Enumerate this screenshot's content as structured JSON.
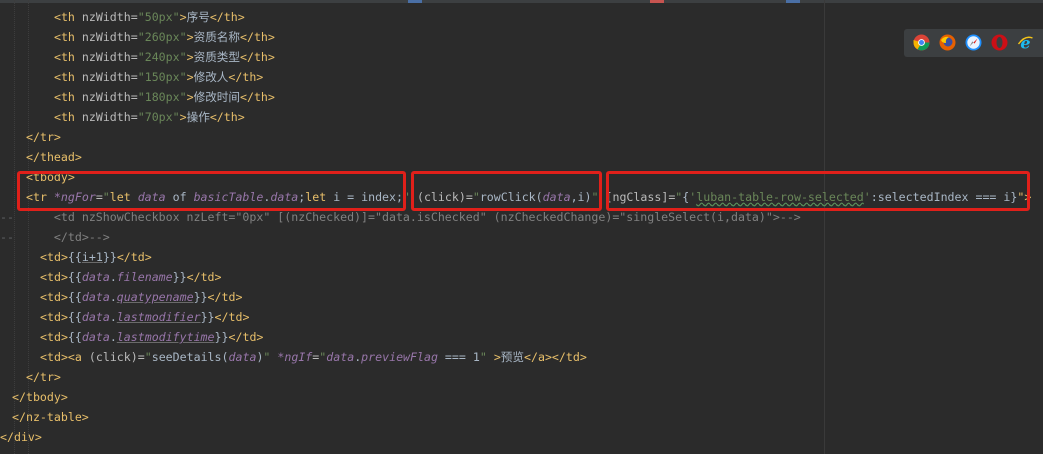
{
  "code_lines": [
    [
      {
        "t": "  <th ",
        "c": "tag"
      },
      {
        "t": "nzWidth=",
        "c": "attr"
      },
      {
        "t": "\"50px\"",
        "c": "str"
      },
      {
        "t": ">",
        "c": "tag"
      },
      {
        "t": "序号",
        "c": "txt"
      },
      {
        "t": "</th>",
        "c": "tag"
      }
    ],
    [
      {
        "t": "  <th ",
        "c": "tag"
      },
      {
        "t": "nzWidth=",
        "c": "attr"
      },
      {
        "t": "\"260px\"",
        "c": "str"
      },
      {
        "t": ">",
        "c": "tag"
      },
      {
        "t": "资质名称",
        "c": "txt"
      },
      {
        "t": "</th>",
        "c": "tag"
      }
    ],
    [
      {
        "t": "  <th ",
        "c": "tag"
      },
      {
        "t": "nzWidth=",
        "c": "attr"
      },
      {
        "t": "\"240px\"",
        "c": "str"
      },
      {
        "t": ">",
        "c": "tag"
      },
      {
        "t": "资质类型",
        "c": "txt"
      },
      {
        "t": "</th>",
        "c": "tag"
      }
    ],
    [
      {
        "t": "  <th ",
        "c": "tag"
      },
      {
        "t": "nzWidth=",
        "c": "attr"
      },
      {
        "t": "\"150px\"",
        "c": "str"
      },
      {
        "t": ">",
        "c": "tag"
      },
      {
        "t": "修改人",
        "c": "txt"
      },
      {
        "t": "</th>",
        "c": "tag"
      }
    ],
    [
      {
        "t": "  <th ",
        "c": "tag"
      },
      {
        "t": "nzWidth=",
        "c": "attr"
      },
      {
        "t": "\"180px\"",
        "c": "str"
      },
      {
        "t": ">",
        "c": "tag"
      },
      {
        "t": "修改时间",
        "c": "txt"
      },
      {
        "t": "</th>",
        "c": "tag"
      }
    ],
    [
      {
        "t": "  <th ",
        "c": "tag"
      },
      {
        "t": "nzWidth=",
        "c": "attr"
      },
      {
        "t": "\"70px\"",
        "c": "str"
      },
      {
        "t": ">",
        "c": "tag"
      },
      {
        "t": "操作",
        "c": "txt"
      },
      {
        "t": "</th>",
        "c": "tag"
      }
    ],
    [
      {
        "t": "</tr>",
        "c": "tag"
      }
    ],
    [
      {
        "t": "</thead>",
        "c": "tag"
      }
    ],
    [
      {
        "t": "<tbody>",
        "c": "tag"
      }
    ],
    [
      {
        "t": "<tr ",
        "c": "tag"
      },
      {
        "t": "*ngFor",
        "c": "purple"
      },
      {
        "t": "=",
        "c": "attr"
      },
      {
        "t": "\"",
        "c": "str"
      },
      {
        "t": "let ",
        "c": "tag"
      },
      {
        "t": "data ",
        "c": "purple"
      },
      {
        "t": "of ",
        "c": "txt"
      },
      {
        "t": "basicTable",
        "c": "purple"
      },
      {
        "t": ".",
        "c": "txt"
      },
      {
        "t": "data",
        "c": "purple"
      },
      {
        "t": ";",
        "c": "txt"
      },
      {
        "t": "let ",
        "c": "tag"
      },
      {
        "t": "i = index",
        "c": "txt"
      },
      {
        "t": ";",
        "c": "txt"
      },
      {
        "t": "\" ",
        "c": "str"
      },
      {
        "t": "(click)",
        "c": "attr"
      },
      {
        "t": "=",
        "c": "attr"
      },
      {
        "t": "\"",
        "c": "str"
      },
      {
        "t": "rowClick",
        "c": "txt"
      },
      {
        "t": "(",
        "c": "txt"
      },
      {
        "t": "data",
        "c": "purple"
      },
      {
        "t": ",i)",
        "c": "txt"
      },
      {
        "t": "\" ",
        "c": "str"
      },
      {
        "t": "[ngClass]",
        "c": "attr"
      },
      {
        "t": "=",
        "c": "attr"
      },
      {
        "t": "\"",
        "c": "str"
      },
      {
        "t": "{",
        "c": "txt"
      },
      {
        "t": "'",
        "c": "str"
      },
      {
        "t": "luban-table-row-selected",
        "c": "str squig"
      },
      {
        "t": "'",
        "c": "str"
      },
      {
        "t": ":selectedIndex === i}",
        "c": "txt"
      },
      {
        "t": "\">",
        "c": "tag"
      }
    ],
    [
      {
        "t": "    <td nzShowCheckbox nzLeft=\"0px\" [(nzChecked)]=\"data.isChecked\" (nzCheckedChange)=\"singleSelect(i,data)\">-->",
        "c": "cmt"
      }
    ],
    [
      {
        "t": "    </td>-->",
        "c": "cmt"
      }
    ],
    [
      {
        "t": "<td>",
        "c": "tag"
      },
      {
        "t": "{{",
        "c": "txt"
      },
      {
        "t": "i+1",
        "c": "txt uline"
      },
      {
        "t": "}}",
        "c": "txt"
      },
      {
        "t": "</td>",
        "c": "tag"
      }
    ],
    [
      {
        "t": "<td>",
        "c": "tag"
      },
      {
        "t": "{{",
        "c": "txt"
      },
      {
        "t": "data",
        "c": "purple"
      },
      {
        "t": ".",
        "c": "txt"
      },
      {
        "t": "filename",
        "c": "purple"
      },
      {
        "t": "}}",
        "c": "txt"
      },
      {
        "t": "</td>",
        "c": "tag"
      }
    ],
    [
      {
        "t": "<td>",
        "c": "tag"
      },
      {
        "t": "{{",
        "c": "txt"
      },
      {
        "t": "data",
        "c": "purple"
      },
      {
        "t": ".",
        "c": "txt"
      },
      {
        "t": "quatypename",
        "c": "purple uline"
      },
      {
        "t": "}}",
        "c": "txt"
      },
      {
        "t": "</td>",
        "c": "tag"
      }
    ],
    [
      {
        "t": "<td>",
        "c": "tag"
      },
      {
        "t": "{{",
        "c": "txt"
      },
      {
        "t": "data",
        "c": "purple"
      },
      {
        "t": ".",
        "c": "txt"
      },
      {
        "t": "lastmodifier",
        "c": "purple uline"
      },
      {
        "t": "}}",
        "c": "txt"
      },
      {
        "t": "</td>",
        "c": "tag"
      }
    ],
    [
      {
        "t": "<td>",
        "c": "tag"
      },
      {
        "t": "{{",
        "c": "txt"
      },
      {
        "t": "data",
        "c": "purple"
      },
      {
        "t": ".",
        "c": "txt"
      },
      {
        "t": "lastmodifytime",
        "c": "purple uline"
      },
      {
        "t": "}}",
        "c": "txt"
      },
      {
        "t": "</td>",
        "c": "tag"
      }
    ],
    [
      {
        "t": "<td>",
        "c": "tag"
      },
      {
        "t": "<a ",
        "c": "tag"
      },
      {
        "t": "(click)",
        "c": "attr"
      },
      {
        "t": "=",
        "c": "attr"
      },
      {
        "t": "\"",
        "c": "str"
      },
      {
        "t": "seeDetails",
        "c": "txt"
      },
      {
        "t": "(",
        "c": "txt"
      },
      {
        "t": "data",
        "c": "purple"
      },
      {
        "t": ")",
        "c": "txt"
      },
      {
        "t": "\" ",
        "c": "str"
      },
      {
        "t": "*ngIf",
        "c": "purple"
      },
      {
        "t": "=",
        "c": "attr"
      },
      {
        "t": "\"",
        "c": "str"
      },
      {
        "t": "data",
        "c": "purple"
      },
      {
        "t": ".",
        "c": "txt"
      },
      {
        "t": "previewFlag",
        "c": "purple"
      },
      {
        "t": " === 1",
        "c": "txt"
      },
      {
        "t": "\" ",
        "c": "str"
      },
      {
        "t": ">",
        "c": "tag"
      },
      {
        "t": "预览",
        "c": "txt"
      },
      {
        "t": "</a>",
        "c": "tag"
      },
      {
        "t": "</td>",
        "c": "tag"
      }
    ],
    [
      {
        "t": "</tr>",
        "c": "tag"
      }
    ],
    [
      {
        "t": "</tbody>",
        "c": "tag"
      }
    ],
    [
      {
        "t": "</nz-table>",
        "c": "tag"
      }
    ],
    [
      {
        "t": "</div>",
        "c": "tag"
      }
    ]
  ],
  "gutter": [
    "",
    "",
    "",
    "",
    "",
    "",
    "",
    "",
    "",
    "",
    "--",
    "--",
    "",
    "",
    "",
    "",
    "",
    "",
    "",
    "",
    "",
    ""
  ],
  "browser_icons": [
    {
      "name": "chrome-icon",
      "color": "#4285f4"
    },
    {
      "name": "firefox-icon",
      "color": "#e66000"
    },
    {
      "name": "safari-icon",
      "color": "#1e90ff"
    },
    {
      "name": "opera-icon",
      "color": "#cc0f16"
    },
    {
      "name": "ie-icon",
      "color": "#1ebbee"
    }
  ],
  "colors": {
    "background": "#2b2b2b",
    "tag": "#e8bf6a",
    "attribute": "#bababa",
    "string": "#6a8759",
    "text": "#a9b7c6",
    "comment": "#808080",
    "field": "#9876aa",
    "highlight_box": "#e0201a"
  }
}
